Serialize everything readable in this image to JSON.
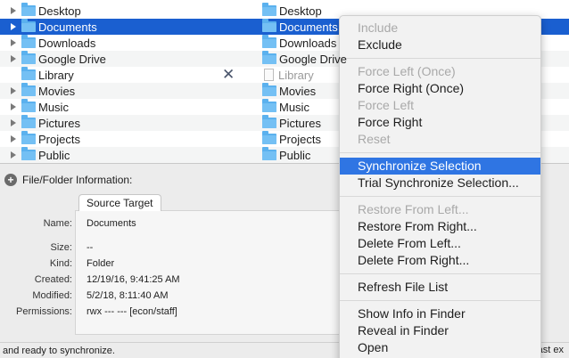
{
  "file_list": {
    "rows": [
      {
        "name": "Desktop",
        "selected": false,
        "expandable": true,
        "is_alias": false
      },
      {
        "name": "Documents",
        "selected": true,
        "expandable": true,
        "is_alias": false
      },
      {
        "name": "Downloads",
        "selected": false,
        "expandable": true,
        "is_alias": false
      },
      {
        "name": "Google Drive",
        "selected": false,
        "expandable": true,
        "is_alias": false
      },
      {
        "name": "Library",
        "selected": false,
        "expandable": false,
        "is_alias": true
      },
      {
        "name": "Movies",
        "selected": false,
        "expandable": true,
        "is_alias": false
      },
      {
        "name": "Music",
        "selected": false,
        "expandable": true,
        "is_alias": false
      },
      {
        "name": "Pictures",
        "selected": false,
        "expandable": true,
        "is_alias": false
      },
      {
        "name": "Projects",
        "selected": false,
        "expandable": true,
        "is_alias": false
      },
      {
        "name": "Public",
        "selected": false,
        "expandable": true,
        "is_alias": false
      }
    ],
    "action_icon": "x-mark-icon"
  },
  "info": {
    "header": "File/Folder Information:",
    "tab_label": "Source Target",
    "fields": [
      {
        "label": "Name:",
        "value": "Documents"
      },
      {
        "label": "Size:",
        "value": "--"
      },
      {
        "label": "Kind:",
        "value": "Folder"
      },
      {
        "label": "Created:",
        "value": "12/19/16, 9:41:25 AM"
      },
      {
        "label": "Modified:",
        "value": "5/2/18, 8:11:40 AM"
      },
      {
        "label": "Permissions:",
        "value": "rwx --- ---   [econ/staff]"
      }
    ]
  },
  "status": {
    "left_text": "and ready to synchronize.",
    "right_text": "last ex"
  },
  "context_menu": {
    "groups": [
      [
        {
          "label": "Include",
          "enabled": false
        },
        {
          "label": "Exclude",
          "enabled": true
        }
      ],
      [
        {
          "label": "Force Left (Once)",
          "enabled": false
        },
        {
          "label": "Force Right (Once)",
          "enabled": true
        },
        {
          "label": "Force Left",
          "enabled": false
        },
        {
          "label": "Force Right",
          "enabled": true
        },
        {
          "label": "Reset",
          "enabled": false
        }
      ],
      [
        {
          "label": "Synchronize Selection",
          "enabled": true,
          "highlighted": true
        },
        {
          "label": "Trial Synchronize Selection...",
          "enabled": true
        }
      ],
      [
        {
          "label": "Restore From Left...",
          "enabled": false
        },
        {
          "label": "Restore From Right...",
          "enabled": true
        },
        {
          "label": "Delete From Left...",
          "enabled": true
        },
        {
          "label": "Delete From Right...",
          "enabled": true
        }
      ],
      [
        {
          "label": "Refresh File List",
          "enabled": true
        }
      ],
      [
        {
          "label": "Show Info in Finder",
          "enabled": true
        },
        {
          "label": "Reveal in Finder",
          "enabled": true
        },
        {
          "label": "Open",
          "enabled": true
        }
      ]
    ]
  },
  "colors": {
    "selection": "#1a5fd0",
    "menu_highlight": "#2f75e3",
    "folder": "#5bb1ee"
  }
}
